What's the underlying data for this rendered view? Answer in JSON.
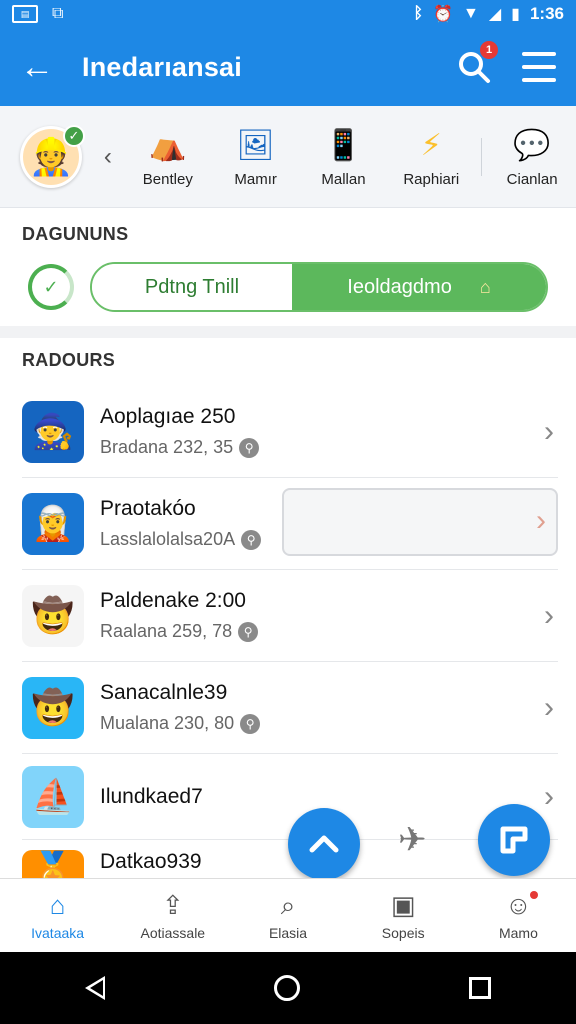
{
  "status_bar": {
    "time": "1:36",
    "icons": [
      "sim-icon",
      "cast-icon",
      "bluetooth-icon",
      "alarm-icon",
      "wifi-icon",
      "signal-icon",
      "battery-icon"
    ]
  },
  "app_bar": {
    "title": "Inedarıansai",
    "search_badge": "1",
    "back_icon": "back-arrow-icon",
    "menu_icon": "menu-icon"
  },
  "categories": [
    {
      "label": "Bentley",
      "icon": "tent-icon"
    },
    {
      "label": "Mamır",
      "icon": "tablet-icon"
    },
    {
      "label": "Mallan",
      "icon": "phone-icon"
    },
    {
      "label": "Raphiari",
      "icon": "bolt-icon"
    },
    {
      "label": "Cianlan",
      "icon": "chat-icon"
    }
  ],
  "section1": {
    "title": "DAGUNUNS"
  },
  "toggle": {
    "option1": "Pdtng Tnill",
    "option2": "Ieoldagdmo"
  },
  "section2": {
    "title": "RADOURS"
  },
  "list": [
    {
      "name": "Aoplagıae 250",
      "meta": "Bradana 232, 35",
      "thumb_color": "#1565c0"
    },
    {
      "name": "Praotakóo",
      "meta": "Lasslalolalsa20A",
      "thumb_color": "#1976d2"
    },
    {
      "name": "Paldenake 2:00",
      "meta": "Raalana 259, 78",
      "thumb_color": "#f5f5f5"
    },
    {
      "name": "Sanacalnle39",
      "meta": "Mualana 230, 80",
      "thumb_color": "#29b6f6"
    },
    {
      "name": "Ilundkaed7",
      "meta": "",
      "thumb_color": "#81d4fa"
    },
    {
      "name": "Datkao939",
      "meta": "",
      "thumb_color": "#ff8f00"
    }
  ],
  "bottom_nav": [
    {
      "label": "Ivataaka",
      "icon": "home-icon",
      "active": true
    },
    {
      "label": "Aotiassale",
      "icon": "upload-icon",
      "active": false
    },
    {
      "label": "Elasia",
      "icon": "search-icon",
      "active": false
    },
    {
      "label": "Sopeis",
      "icon": "note-icon",
      "active": false
    },
    {
      "label": "Mamo",
      "icon": "profile-icon",
      "active": false
    }
  ],
  "colors": {
    "primary": "#1e88e5",
    "green": "#5cb85c",
    "badge": "#e53935"
  }
}
